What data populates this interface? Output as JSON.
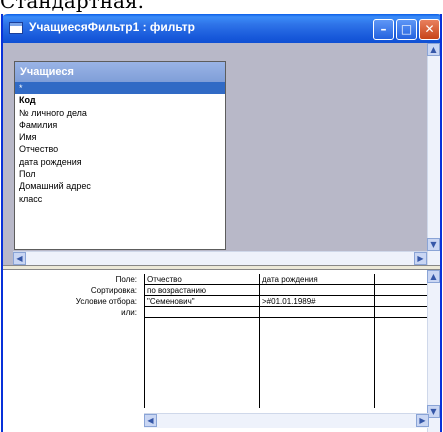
{
  "top_fragment": "Стандартная.",
  "window": {
    "title": "УчащиесяФильтр1 : фильтр"
  },
  "titlebar_buttons": {
    "minimize": "–",
    "maximize": "□",
    "close": "✕"
  },
  "field_list": {
    "title": "Учащиеся",
    "items": [
      "*",
      "Код",
      "№ личного дела",
      "Фамилия",
      "Имя",
      "Отчество",
      "дата рождения",
      "Пол",
      "Домашний адрес",
      "класс"
    ]
  },
  "grid": {
    "row_labels": [
      "Поле:",
      "Сортировка:",
      "Условие отбора:",
      "или:"
    ],
    "columns": [
      {
        "field": "Отчество",
        "sort": "по возрастанию",
        "criteria": "\"Семенович\"",
        "or": ""
      },
      {
        "field": "дата рождения",
        "sort": "",
        "criteria": ">#01.01.1989#",
        "or": ""
      },
      {
        "field": "",
        "sort": "",
        "criteria": "",
        "or": ""
      }
    ]
  },
  "icons": {
    "scroll_up": "up-arrow",
    "scroll_down": "down-arrow",
    "scroll_left": "left-arrow",
    "scroll_right": "right-arrow"
  }
}
